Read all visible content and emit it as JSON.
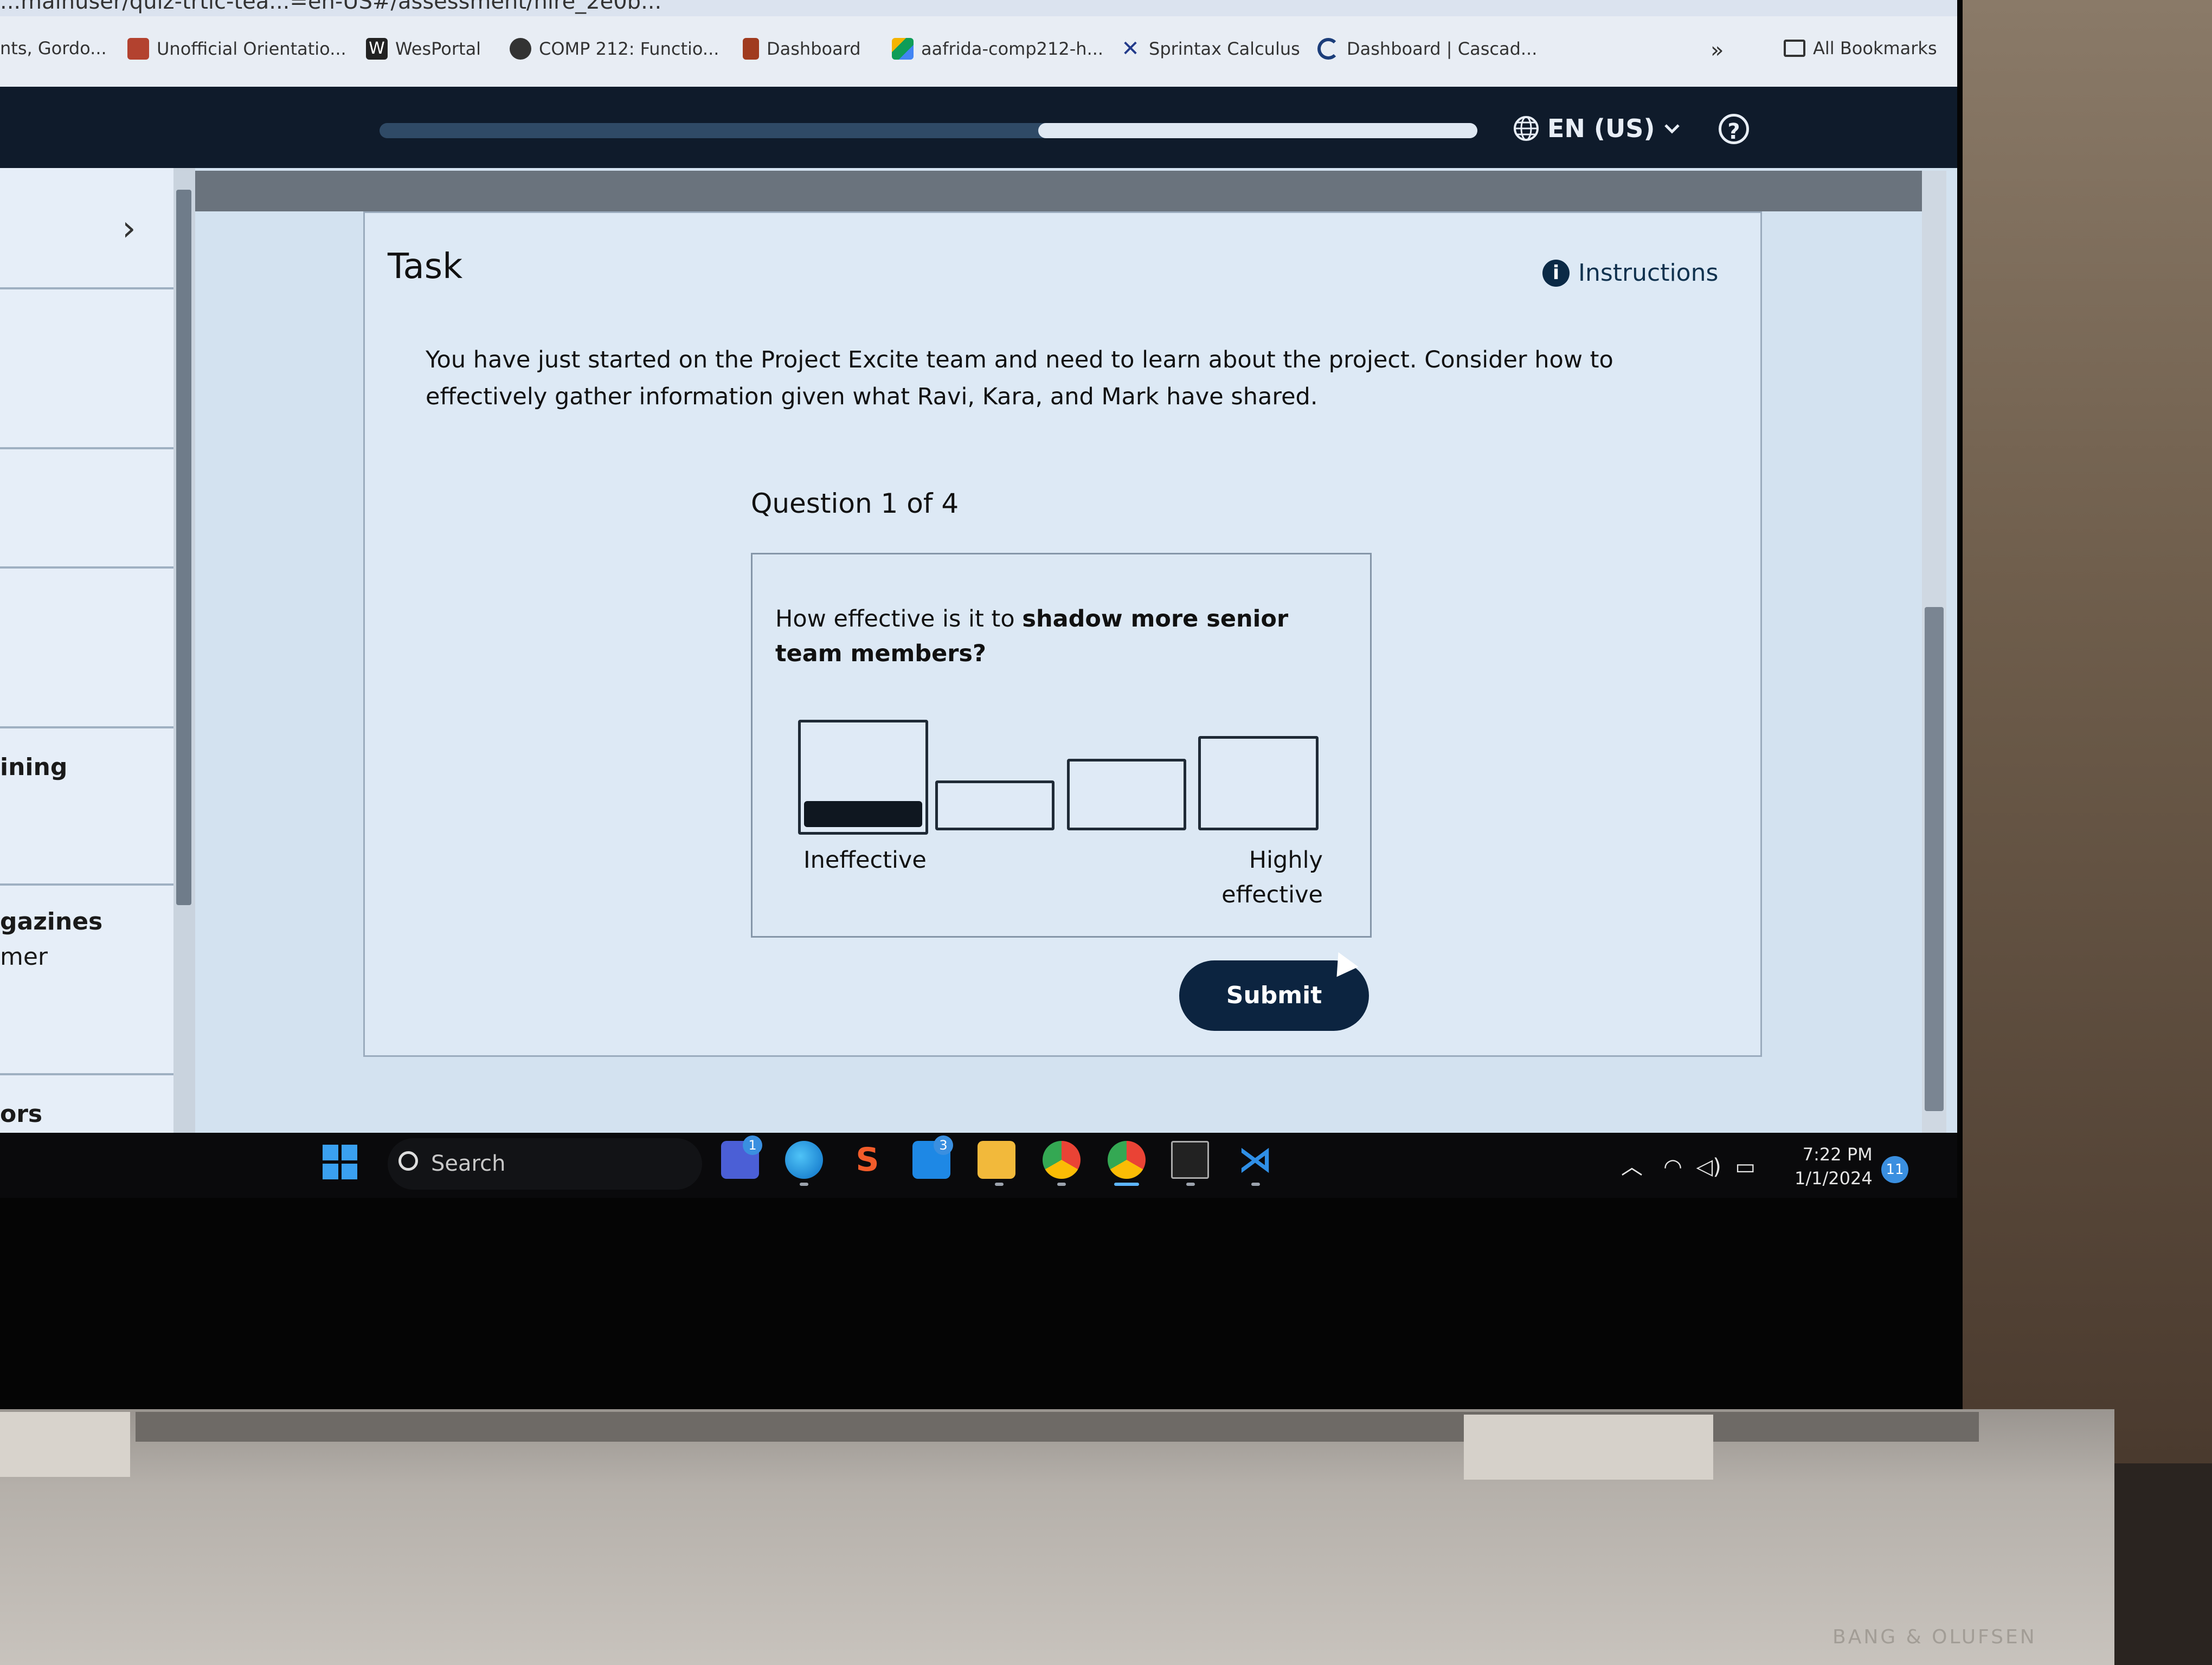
{
  "browser": {
    "url_fragment": "...mainuser/quiz-trtic-tea...=en-US#/assessment/hire_2e0b...",
    "bookmarks": [
      {
        "label": "nts, Gordo...",
        "icon": "bookmark-icon"
      },
      {
        "label": "Unofficial Orientatio...",
        "icon": "calendar-icon"
      },
      {
        "label": "WesPortal",
        "icon": "w-logo-icon"
      },
      {
        "label": "COMP 212: Functio...",
        "icon": "globe-icon"
      },
      {
        "label": "Dashboard",
        "icon": "dashboard-icon"
      },
      {
        "label": "aafrida-comp212-h...",
        "icon": "drive-icon"
      },
      {
        "label": "Sprintax Calculus",
        "icon": "sprintax-icon"
      },
      {
        "label": "Dashboard | Cascad...",
        "icon": "cascade-icon"
      }
    ],
    "overflow_label": "»",
    "all_bookmarks": "All Bookmarks"
  },
  "header": {
    "progress": 0.4,
    "language": "EN (US)",
    "help_glyph": "?"
  },
  "sidebar": {
    "fragments": [
      "ining",
      "gazines",
      "mer",
      "ors"
    ]
  },
  "task": {
    "title": "Task",
    "instructions_label": "Instructions",
    "description": "You have just started on the Project Excite team and need to learn about the project. Consider how to effectively gather information given what Ravi, Kara, and Mark have shared.",
    "question_counter": "Question 1 of 4",
    "question_prefix": "How effective is it to ",
    "question_bold": "shadow more senior team members?",
    "scale": {
      "options": 4,
      "selected_index": 0,
      "low_label": "Ineffective",
      "high_label": "Highly effective"
    },
    "submit_label": "Submit"
  },
  "taskbar": {
    "search_placeholder": "Search",
    "time": "7:22 PM",
    "date": "1/1/2024",
    "notification_count": "11",
    "teams_badge": "1",
    "mail_badge": "3"
  },
  "colors": {
    "header_bg": "#0f1b2b",
    "submit_bg": "#0c2440",
    "content_bg": "#d3e2f0"
  }
}
